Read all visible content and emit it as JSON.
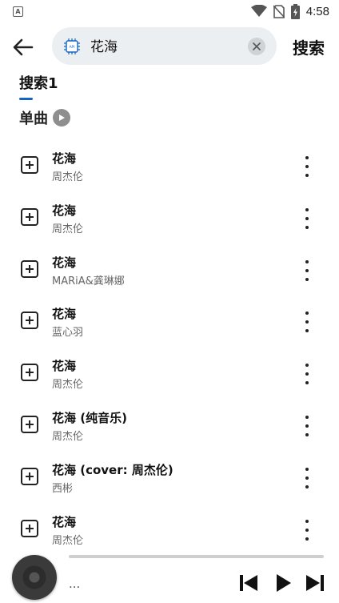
{
  "status_bar": {
    "time": "4:58",
    "notification_icon": "a-letter-icon",
    "icons": [
      "wifi-icon",
      "no-sim-icon",
      "battery-charging-icon"
    ]
  },
  "header": {
    "back_icon": "arrow-left-icon",
    "search_icon": "api-chip-icon",
    "search_value": "花海",
    "clear_icon": "close-icon",
    "search_button": "搜索"
  },
  "tabs": [
    {
      "label": "搜索1",
      "active": true
    }
  ],
  "section": {
    "title": "单曲",
    "play_icon": "play-circle-icon"
  },
  "songs": [
    {
      "title": "花海",
      "artist": "周杰伦"
    },
    {
      "title": "花海",
      "artist": "周杰伦"
    },
    {
      "title": "花海",
      "artist": "MARiA&龚琳娜"
    },
    {
      "title": "花海",
      "artist": "蓝心羽"
    },
    {
      "title": "花海",
      "artist": "周杰伦"
    },
    {
      "title": "花海 (纯音乐)",
      "artist": "周杰伦"
    },
    {
      "title": "花海 (cover: 周杰伦)",
      "artist": "西彬"
    },
    {
      "title": "花海",
      "artist": "周杰伦"
    }
  ],
  "player": {
    "now_playing": "...",
    "progress": 0,
    "controls": [
      "skip-previous-icon",
      "play-icon",
      "skip-next-icon"
    ]
  },
  "colors": {
    "accent": "#1565c0",
    "search_bg": "#eceff1"
  }
}
